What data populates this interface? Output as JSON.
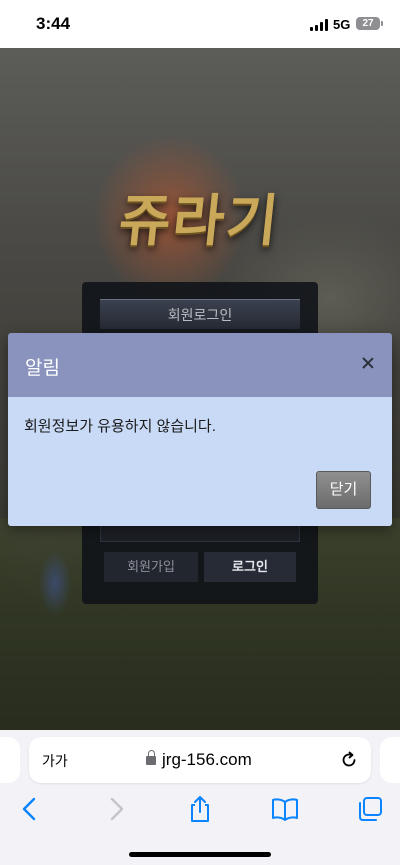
{
  "status_bar": {
    "time": "3:44",
    "network": "5G",
    "battery": "27"
  },
  "site": {
    "logo_text": "쥬라기",
    "login_title": "회원로그인",
    "join_button": "회원가입",
    "login_button": "로그인"
  },
  "dialog": {
    "title": "알림",
    "message": "회원정보가 유용하지 않습니다.",
    "close_button": "닫기"
  },
  "browser": {
    "text_size_label": "가가",
    "url": "jrg-156.com",
    "toolbar_icons": [
      "back-icon",
      "forward-icon",
      "share-icon",
      "bookmarks-icon",
      "tabs-icon"
    ],
    "accent_color": "#0a84ff"
  }
}
